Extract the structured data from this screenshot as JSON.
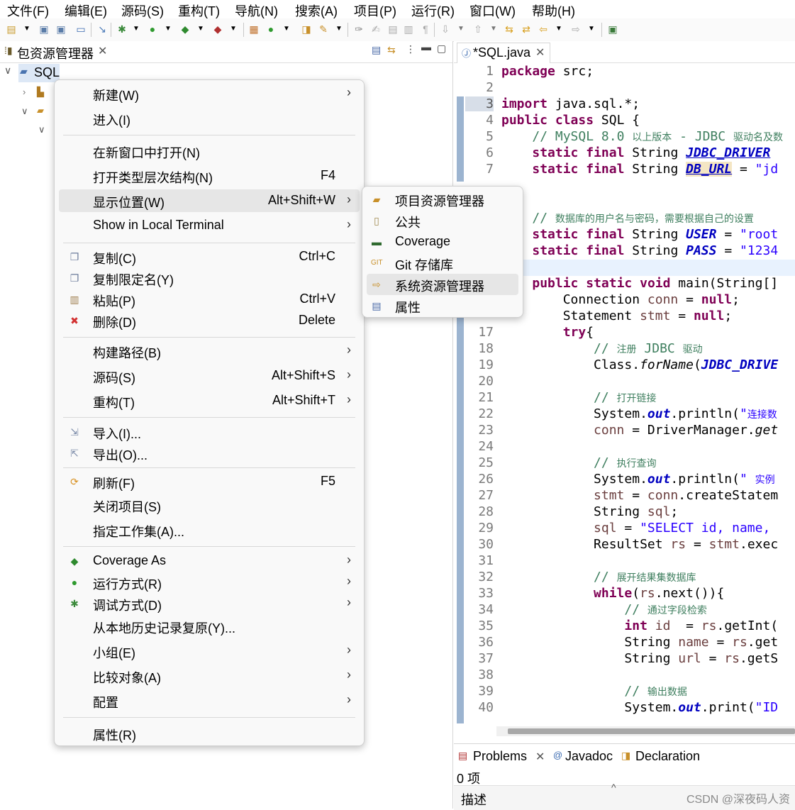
{
  "menubar": [
    "文件(F)",
    "编辑(E)",
    "源码(S)",
    "重构(T)",
    "导航(N)",
    "搜索(A)",
    "项目(P)",
    "运行(R)",
    "窗口(W)",
    "帮助(H)"
  ],
  "left_view": {
    "tab_title": "包资源管理器",
    "tree_project": "SQL"
  },
  "editor": {
    "tab_title": "*SQL.java",
    "lines": [
      {
        "n": "1",
        "t": "package src;"
      },
      {
        "n": "2",
        "t": ""
      },
      {
        "n": "3",
        "t": "import java.sql.*;"
      },
      {
        "n": "4",
        "t": "public class SQL {"
      },
      {
        "n": "5",
        "t": "    // MySQL 8.0 以上版本 - JDBC 驱动名及数"
      },
      {
        "n": "6",
        "t": "    static final String JDBC_DRIVER"
      },
      {
        "n": "7",
        "t": "    static final String DB_URL = \"jd"
      },
      {
        "n": "17",
        "t": "        try{"
      },
      {
        "n": "18",
        "t": "            // 注册 JDBC 驱动"
      },
      {
        "n": "19",
        "t": "            Class.forName(JDBC_DRIVE"
      },
      {
        "n": "20",
        "t": ""
      },
      {
        "n": "21",
        "t": "            // 打开链接"
      },
      {
        "n": "22",
        "t": "            System.out.println(\"连接数"
      },
      {
        "n": "23",
        "t": "            conn = DriverManager.get"
      },
      {
        "n": "24",
        "t": ""
      },
      {
        "n": "25",
        "t": "            // 执行查询"
      },
      {
        "n": "26",
        "t": "            System.out.println(\" 实例"
      },
      {
        "n": "27",
        "t": "            stmt = conn.createStatem"
      },
      {
        "n": "28",
        "t": "            String sql;"
      },
      {
        "n": "29",
        "t": "            sql = \"SELECT id, name, "
      },
      {
        "n": "30",
        "t": "            ResultSet rs = stmt.exec"
      },
      {
        "n": "31",
        "t": ""
      },
      {
        "n": "32",
        "t": "            // 展开结果集数据库"
      },
      {
        "n": "33",
        "t": "            while(rs.next()){"
      },
      {
        "n": "34",
        "t": "                // 通过字段检索"
      },
      {
        "n": "35",
        "t": "                int id  = rs.getInt("
      },
      {
        "n": "36",
        "t": "                String name = rs.get"
      },
      {
        "n": "37",
        "t": "                String url = rs.getS"
      },
      {
        "n": "38",
        "t": ""
      },
      {
        "n": "39",
        "t": "                // 输出数据"
      },
      {
        "n": "40",
        "t": "                System.out.print(\"ID"
      }
    ],
    "hidden_lines": [
      "    // 数据库的用户名与密码，需要根据自己的设置",
      "    static final String USER = \"root",
      "    static final String PASS = \"1234",
      "    public static void main(String[]",
      "        Connection conn = null;",
      "        Statement stmt = null;"
    ]
  },
  "context_menu": {
    "items": [
      {
        "label": "新建(W)",
        "accel": "",
        "submenu": true,
        "icon": ""
      },
      {
        "label": "进入(I)",
        "accel": "",
        "submenu": false,
        "icon": ""
      },
      {
        "label": "在新窗口中打开(N)",
        "accel": "",
        "submenu": false,
        "icon": ""
      },
      {
        "label": "打开类型层次结构(N)",
        "accel": "F4",
        "submenu": false,
        "icon": ""
      },
      {
        "label": "显示位置(W)",
        "accel": "Alt+Shift+W",
        "submenu": true,
        "icon": ""
      },
      {
        "label": "Show in Local Terminal",
        "accel": "",
        "submenu": true,
        "icon": ""
      },
      {
        "label": "复制(C)",
        "accel": "Ctrl+C",
        "submenu": false,
        "icon": "copy-icon"
      },
      {
        "label": "复制限定名(Y)",
        "accel": "",
        "submenu": false,
        "icon": "copy-qualified-icon"
      },
      {
        "label": "粘贴(P)",
        "accel": "Ctrl+V",
        "submenu": false,
        "icon": "paste-icon"
      },
      {
        "label": "删除(D)",
        "accel": "Delete",
        "submenu": false,
        "icon": "delete-icon"
      },
      {
        "label": "构建路径(B)",
        "accel": "",
        "submenu": true,
        "icon": ""
      },
      {
        "label": "源码(S)",
        "accel": "Alt+Shift+S",
        "submenu": true,
        "icon": ""
      },
      {
        "label": "重构(T)",
        "accel": "Alt+Shift+T",
        "submenu": true,
        "icon": ""
      },
      {
        "label": "导入(I)...",
        "accel": "",
        "submenu": false,
        "icon": "import-icon"
      },
      {
        "label": "导出(O)...",
        "accel": "",
        "submenu": false,
        "icon": "export-icon"
      },
      {
        "label": "刷新(F)",
        "accel": "F5",
        "submenu": false,
        "icon": "refresh-icon"
      },
      {
        "label": "关闭项目(S)",
        "accel": "",
        "submenu": false,
        "icon": ""
      },
      {
        "label": "指定工作集(A)...",
        "accel": "",
        "submenu": false,
        "icon": ""
      },
      {
        "label": "Coverage As",
        "accel": "",
        "submenu": true,
        "icon": "coverage-icon"
      },
      {
        "label": "运行方式(R)",
        "accel": "",
        "submenu": true,
        "icon": "run-icon"
      },
      {
        "label": "调试方式(D)",
        "accel": "",
        "submenu": true,
        "icon": "debug-icon"
      },
      {
        "label": "从本地历史记录复原(Y)...",
        "accel": "",
        "submenu": false,
        "icon": ""
      },
      {
        "label": "小组(E)",
        "accel": "",
        "submenu": true,
        "icon": ""
      },
      {
        "label": "比较对象(A)",
        "accel": "",
        "submenu": true,
        "icon": ""
      },
      {
        "label": "配置",
        "accel": "",
        "submenu": true,
        "icon": ""
      },
      {
        "label": "属性(R)",
        "accel": "",
        "submenu": false,
        "icon": ""
      }
    ],
    "highlighted": "显示位置(W)"
  },
  "submenu": {
    "items": [
      {
        "label": "项目资源管理器",
        "icon": "project-explorer-icon"
      },
      {
        "label": "公共",
        "icon": "common-icon"
      },
      {
        "label": "Coverage",
        "icon": "coverage-view-icon"
      },
      {
        "label": "Git 存储库",
        "icon": "git-repo-icon"
      },
      {
        "label": "系统资源管理器",
        "icon": "system-explorer-icon"
      },
      {
        "label": "属性",
        "icon": "properties-icon"
      }
    ],
    "highlighted": "系统资源管理器"
  },
  "bottom_panel": {
    "tabs": [
      "Problems",
      "Javadoc",
      "Declaration"
    ],
    "count": "0 项",
    "column": "描述"
  },
  "watermark": "CSDN @深夜码人资"
}
